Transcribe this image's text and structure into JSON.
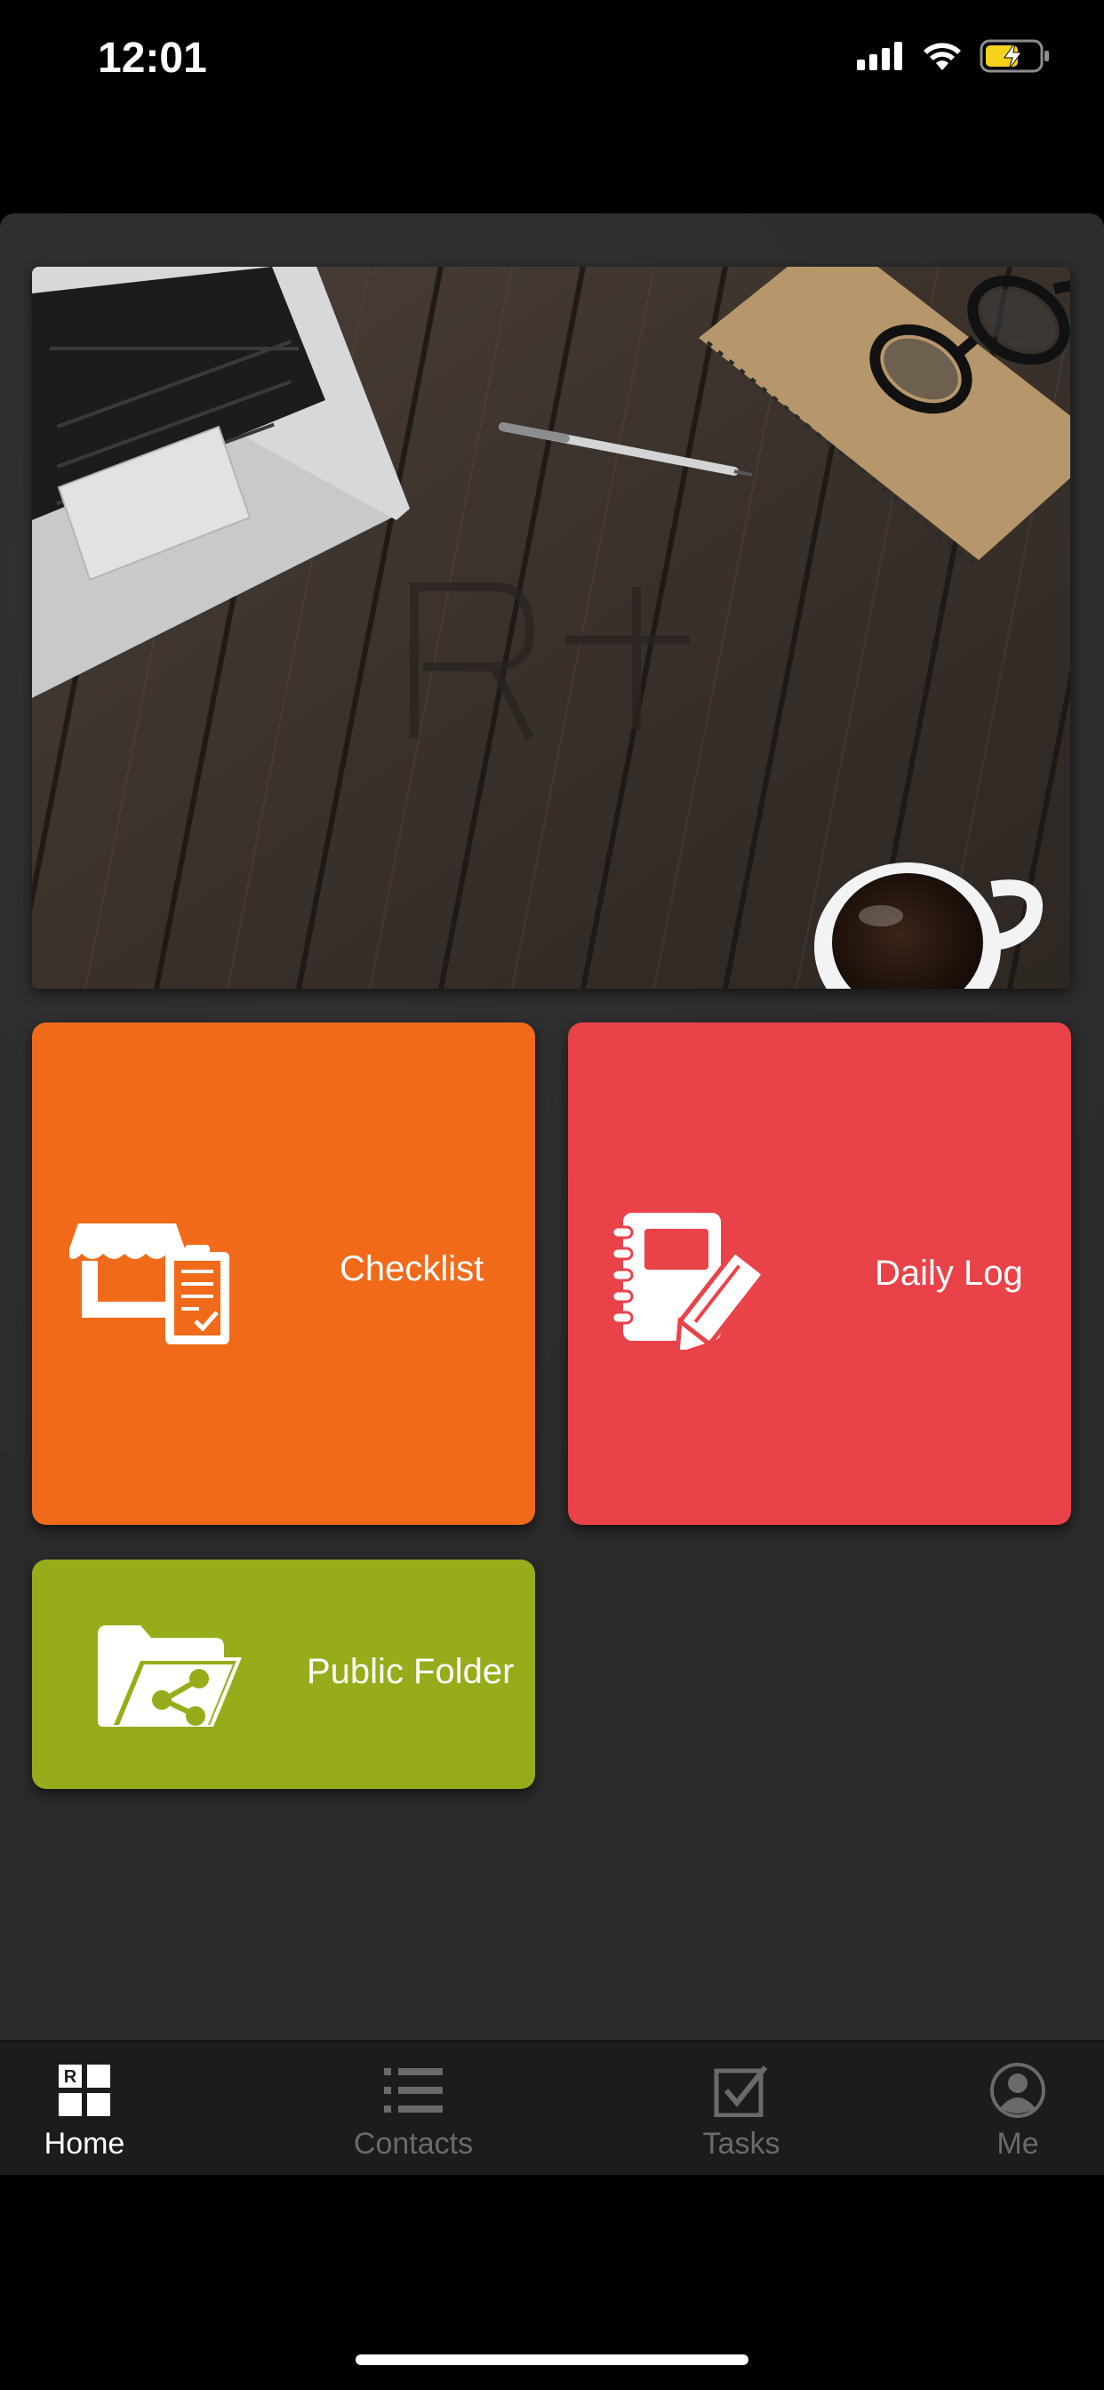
{
  "status_bar": {
    "time": "12:01"
  },
  "tiles": [
    {
      "label": "Checklist",
      "color": "#f06a1a",
      "icon": "store-checklist-icon"
    },
    {
      "label": "Daily Log",
      "color": "#ea4249",
      "icon": "notebook-pencil-icon"
    },
    {
      "label": "Public Folder",
      "color": "#98ab1a",
      "icon": "shared-folder-icon"
    }
  ],
  "tab_bar": {
    "active_color": "#ffffff",
    "inactive_color": "#6a6a6a",
    "items": [
      {
        "label": "Home",
        "icon": "home-grid-icon",
        "active": true
      },
      {
        "label": "Contacts",
        "icon": "list-icon",
        "active": false
      },
      {
        "label": "Tasks",
        "icon": "checkbox-icon",
        "active": false
      },
      {
        "label": "Me",
        "icon": "profile-icon",
        "active": false
      }
    ]
  }
}
